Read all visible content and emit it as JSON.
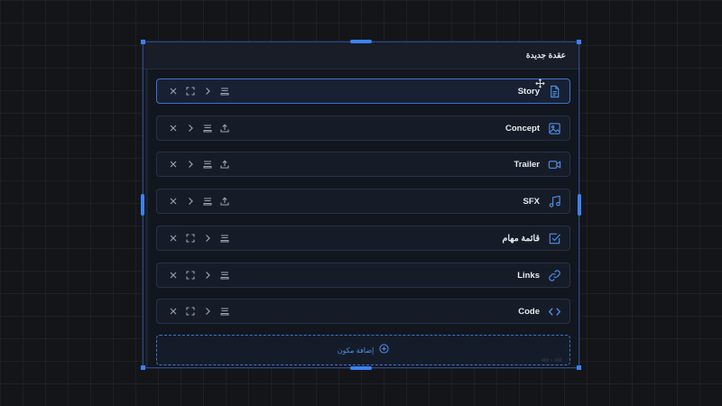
{
  "node": {
    "title": "عقدة جديدة",
    "size_hint": "480 × 360"
  },
  "rows": [
    {
      "label": "Story",
      "icon": "document-icon",
      "actions": [
        "close",
        "expand",
        "chevron",
        "stack"
      ],
      "active": true
    },
    {
      "label": "Concept",
      "icon": "image-icon",
      "actions": [
        "close",
        "chevron",
        "stack",
        "upload"
      ],
      "active": false
    },
    {
      "label": "Trailer",
      "icon": "video-icon",
      "actions": [
        "close",
        "chevron",
        "stack",
        "upload"
      ],
      "active": false
    },
    {
      "label": "SFX",
      "icon": "music-icon",
      "actions": [
        "close",
        "chevron",
        "stack",
        "upload"
      ],
      "active": false
    },
    {
      "label": "قائمة مهام",
      "icon": "checkbox-icon",
      "actions": [
        "close",
        "expand",
        "chevron",
        "stack"
      ],
      "active": false
    },
    {
      "label": "Links",
      "icon": "link-icon",
      "actions": [
        "close",
        "expand",
        "chevron",
        "stack"
      ],
      "active": false
    },
    {
      "label": "Code",
      "icon": "code-icon",
      "actions": [
        "close",
        "expand",
        "chevron",
        "stack"
      ],
      "active": false
    }
  ],
  "add_button": {
    "label": "إضافة مكون",
    "icon": "plus-circle-icon"
  },
  "colors": {
    "accent": "#3b82f6",
    "background": "#141519",
    "panel": "#12161f",
    "row": "#161c27",
    "text": "#e8eaf0",
    "action": "#9aa3b2"
  }
}
